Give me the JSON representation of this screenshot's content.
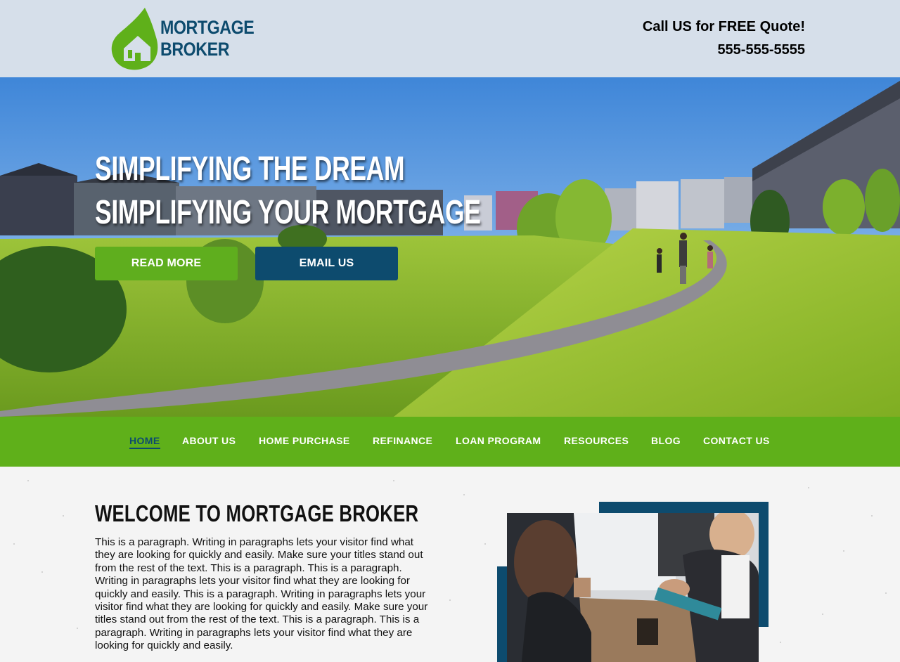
{
  "header": {
    "logo": {
      "line1": "MORTGAGE",
      "line2": "BROKER",
      "icon": "house-drop-logo-icon"
    },
    "call_line": "Call US for FREE Quote!",
    "phone": "555-555-5555"
  },
  "hero": {
    "title_line1": "SIMPLIFYING THE DREAM",
    "title_line2": "SIMPLIFYING YOUR MORTGAGE",
    "read_more_label": "READ MORE",
    "email_us_label": "EMAIL US"
  },
  "nav": {
    "items": [
      {
        "label": "HOME",
        "active": true
      },
      {
        "label": "ABOUT US"
      },
      {
        "label": "HOME PURCHASE"
      },
      {
        "label": "REFINANCE"
      },
      {
        "label": "LOAN PROGRAM"
      },
      {
        "label": "RESOURCES"
      },
      {
        "label": "BLOG"
      },
      {
        "label": "CONTACT US"
      }
    ]
  },
  "welcome": {
    "heading": "WELCOME TO MORTGAGE BROKER",
    "paragraph": "This is a paragraph. Writing in paragraphs lets your visitor find what they are looking for quickly and easily. Make sure your titles stand out from the rest of the text. This is a paragraph. This is a paragraph. Writing in paragraphs lets your visitor find what they are looking for quickly and easily. This is a paragraph. Writing in paragraphs lets your visitor find what they are looking for quickly and easily. Make sure your titles stand out from the rest of the text. This is a paragraph. This is a paragraph. Writing in paragraphs lets your visitor find what they are looking for quickly and easily."
  },
  "colors": {
    "brand_green": "#5fb01a",
    "brand_navy": "#0d4b6e",
    "header_bg": "#d6dfea"
  }
}
